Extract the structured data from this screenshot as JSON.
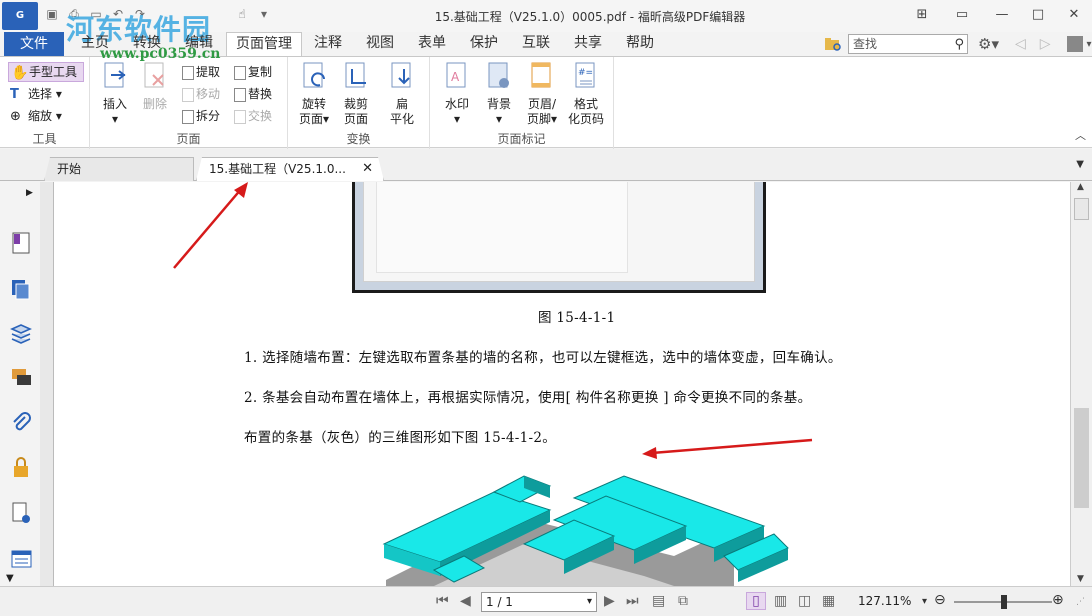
{
  "titlebar": {
    "app_logo": "G",
    "title": "15.基础工程（V25.1.0）0005.pdf - 福昕高级PDF编辑器",
    "watermark": "河东软件园",
    "watermark_url": "www.pc0359.cn"
  },
  "ribbon_tabs": {
    "file": "文件",
    "items": [
      "主页",
      "转换",
      "编辑",
      "页面管理",
      "注释",
      "视图",
      "表单",
      "保护",
      "互联",
      "共享",
      "帮助"
    ],
    "active": "页面管理"
  },
  "search": {
    "placeholder": "查找"
  },
  "ribbon": {
    "tools": {
      "hand": "手型工具",
      "select": "选择",
      "zoom": "缩放",
      "group_label": "工具"
    },
    "page": {
      "insert": "插入",
      "delete": "删除",
      "extract": "提取",
      "move": "移动",
      "split": "拆分",
      "copy": "复制",
      "replace": "替换",
      "swap": "交换",
      "group_label": "页面"
    },
    "transform": {
      "rotate_line1": "旋转",
      "rotate_line2": "页面",
      "crop_line1": "裁剪",
      "crop_line2": "页面",
      "flatten_line1": "扁",
      "flatten_line2": "平化",
      "group_label": "变换"
    },
    "page_marks": {
      "watermark": "水印",
      "background": "背景",
      "header_line1": "页眉/",
      "header_line2": "页脚",
      "bates_line1": "格式",
      "bates_line2": "化页码",
      "group_label": "页面标记"
    }
  },
  "doc_tabs": {
    "start": "开始",
    "current": "15.基础工程（V25.1.0..."
  },
  "document": {
    "figure_caption": "图 15-4-1-1",
    "para1": "1. 选择随墙布置：左键选取布置条基的墙的名称，也可以左键框选，选中的墙体变虚，回车确认。",
    "para2": "2. 条基会自动布置在墙体上，再根据实际情况，使用[ 构件名称更换 ] 命令更换不同的条基。",
    "para3": "布置的条基（灰色）的三维图形如下图 15-4-1-2。"
  },
  "statusbar": {
    "page": "1 / 1",
    "zoom": "127.11%"
  },
  "colors": {
    "accent": "#2a62b8",
    "arrow": "#d61a1a",
    "cyan": "#16e6e6"
  }
}
